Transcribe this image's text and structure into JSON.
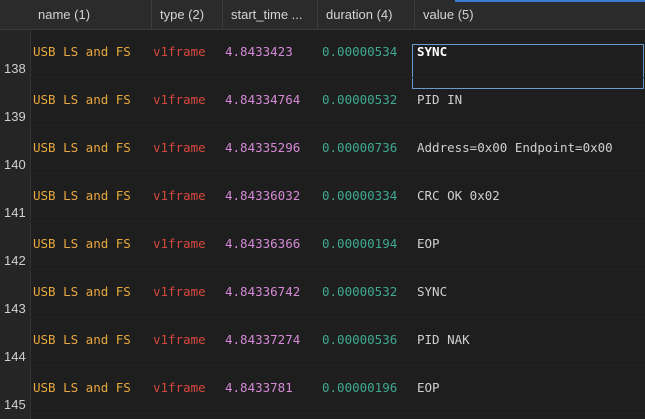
{
  "columns": [
    {
      "label": "name (1)"
    },
    {
      "label": "type (2)"
    },
    {
      "label": "start_time ..."
    },
    {
      "label": "duration (4)"
    },
    {
      "label": "value (5)"
    }
  ],
  "rows": [
    {
      "num": "138",
      "name": "USB LS and FS",
      "type": "v1frame",
      "start_time": "4.8433423",
      "duration": "0.00000534",
      "value": "SYNC"
    },
    {
      "num": "139",
      "name": "USB LS and FS",
      "type": "v1frame",
      "start_time": "4.84334764",
      "duration": "0.00000532",
      "value": "PID IN"
    },
    {
      "num": "140",
      "name": "USB LS and FS",
      "type": "v1frame",
      "start_time": "4.84335296",
      "duration": "0.00000736",
      "value": "Address=0x00 Endpoint=0x00"
    },
    {
      "num": "141",
      "name": "USB LS and FS",
      "type": "v1frame",
      "start_time": "4.84336032",
      "duration": "0.00000334",
      "value": "CRC OK 0x02"
    },
    {
      "num": "142",
      "name": "USB LS and FS",
      "type": "v1frame",
      "start_time": "4.84336366",
      "duration": "0.00000194",
      "value": "EOP"
    },
    {
      "num": "143",
      "name": "USB LS and FS",
      "type": "v1frame",
      "start_time": "4.84336742",
      "duration": "0.00000532",
      "value": "SYNC"
    },
    {
      "num": "144",
      "name": "USB LS and FS",
      "type": "v1frame",
      "start_time": "4.84337274",
      "duration": "0.00000536",
      "value": "PID NAK"
    },
    {
      "num": "145",
      "name": "USB LS and FS",
      "type": "v1frame",
      "start_time": "4.8433781",
      "duration": "0.00000196",
      "value": "EOP"
    }
  ],
  "selected_row": "138",
  "colors": {
    "name": "#e8a93e",
    "type": "#d9483e",
    "start_time": "#d58ad6",
    "duration": "#3ea890",
    "value": "#d0d0d0",
    "accent": "#3a7bd5"
  }
}
